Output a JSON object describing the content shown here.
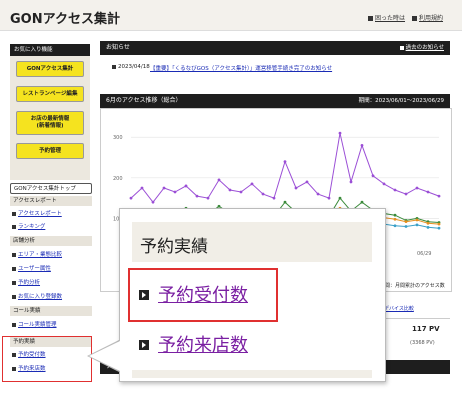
{
  "header": {
    "title": "GONアクセス集計",
    "links": [
      "困った時は",
      "利用規約"
    ]
  },
  "sidebar": {
    "favorites_title": "お気に入り機能",
    "buttons": [
      "GONアクセス集計",
      "レストランページ編集",
      "お店の最新情報\n(新着情報)",
      "予約管理"
    ],
    "top_link": "GONアクセス集計トップ",
    "sections": [
      {
        "title": "アクセスレポート",
        "links": [
          "アクセスレポート",
          "ランキング"
        ]
      },
      {
        "title": "店舗分析",
        "links": [
          "エリア・業態比較",
          "ユーザー属性",
          "予約分析",
          "お気に入り登録数"
        ]
      },
      {
        "title": "コール実績",
        "links": [
          "コール実績管理"
        ]
      },
      {
        "title": "予約実績",
        "links": [
          "予約受付数",
          "予約来店数"
        ]
      }
    ]
  },
  "main": {
    "news_bar": {
      "title": "お知らせ",
      "right": "過去のお知らせ"
    },
    "news": {
      "date": "2023/04/18",
      "text": "【重要】「くるなびGOS（アクセス集計）」運営移管手続き完了のお知らせ"
    },
    "chart_bar": {
      "title": "6月のアクセス推移（総合）",
      "right": "期間：2023/06/01～2023/06/29"
    },
    "stats": {
      "text": "期間：月間累計のアクセス数",
      "link": "デバイス比較",
      "value1": "117 PV",
      "value2": "(3368 PV)"
    },
    "bottom_bar": {
      "title": "アク"
    }
  },
  "popup": {
    "title": "予約実績",
    "links": [
      "予約受付数",
      "予約来店数"
    ]
  },
  "chart_data": {
    "type": "line",
    "title": "",
    "y_ticks": [
      "300",
      "200",
      "100"
    ],
    "x_tick_last": "06/29",
    "colors": {
      "purple": "#9b4fd6",
      "green": "#3a8a3a",
      "orange": "#e69020",
      "teal": "#3aa0c8"
    },
    "series": [
      {
        "values": [
          150,
          175,
          140,
          175,
          165,
          180,
          155,
          150,
          195,
          170,
          165,
          185,
          160,
          150,
          240,
          175,
          190,
          160,
          150,
          310,
          190,
          280,
          205,
          185,
          170,
          160,
          175,
          165,
          155
        ]
      },
      {
        "values": [
          110,
          120,
          105,
          115,
          110,
          125,
          108,
          110,
          130,
          112,
          110,
          120,
          108,
          105,
          140,
          115,
          120,
          110,
          105,
          150,
          118,
          140,
          120,
          112,
          108,
          95,
          100,
          92,
          90
        ]
      },
      {
        "values": [
          95,
          105,
          98,
          100,
          102,
          110,
          96,
          100,
          112,
          100,
          98,
          108,
          100,
          96,
          120,
          104,
          108,
          100,
          96,
          125,
          106,
          120,
          108,
          102,
          98,
          92,
          96,
          88,
          86
        ]
      },
      {
        "values": [
          80,
          88,
          82,
          86,
          84,
          90,
          80,
          84,
          92,
          86,
          82,
          90,
          84,
          80,
          98,
          86,
          90,
          84,
          80,
          100,
          88,
          96,
          90,
          86,
          82,
          80,
          84,
          78,
          76
        ]
      }
    ],
    "ylim": [
      0,
      340
    ]
  }
}
